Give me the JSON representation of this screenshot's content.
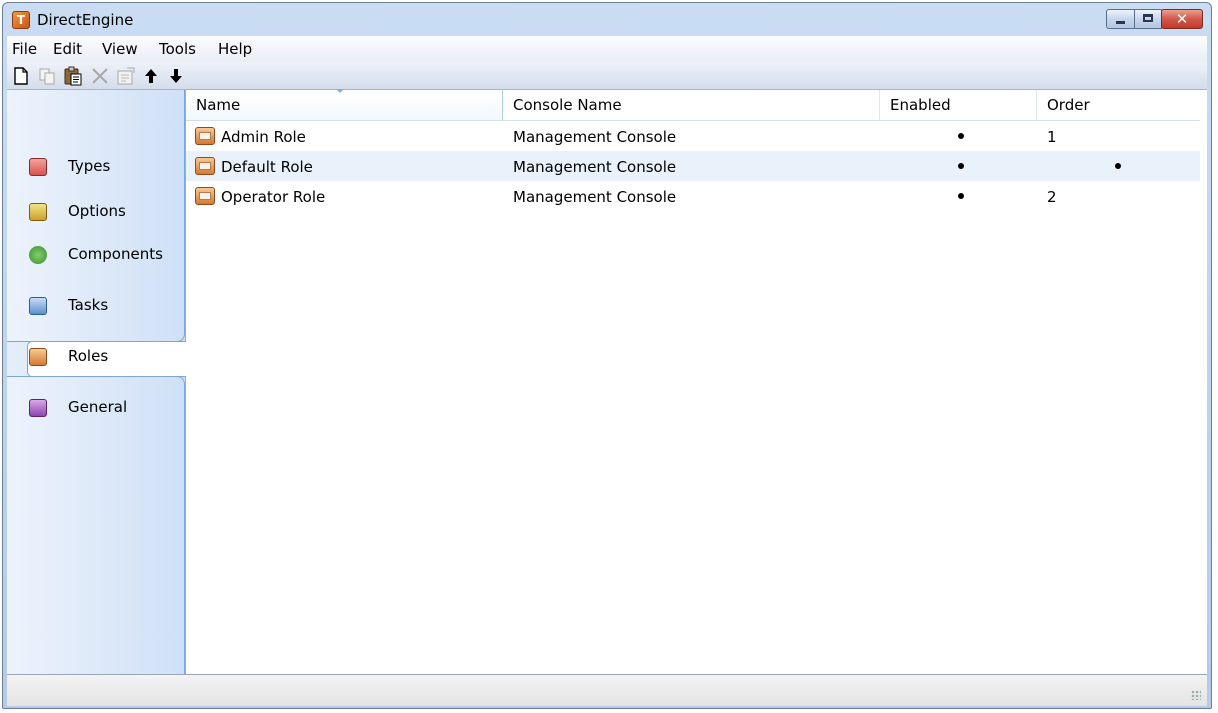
{
  "window": {
    "title": "DirectEngine"
  },
  "menu": {
    "items": [
      "File",
      "Edit",
      "View",
      "Tools",
      "Help"
    ]
  },
  "toolbar": {
    "buttons": [
      {
        "name": "new-icon"
      },
      {
        "name": "copy-icon",
        "disabled": true
      },
      {
        "name": "paste-icon"
      },
      {
        "name": "delete-icon",
        "disabled": true
      },
      {
        "name": "properties-icon",
        "disabled": true
      },
      {
        "name": "move-up-icon",
        "glyph": "🡩"
      },
      {
        "name": "move-down-icon",
        "glyph": "🡫"
      }
    ]
  },
  "nav": {
    "items": [
      {
        "label": "Types",
        "icon": "types-icon",
        "color": "#d9534f"
      },
      {
        "label": "Options",
        "icon": "options-icon",
        "color": "#c9a227"
      },
      {
        "label": "Components",
        "icon": "components-icon",
        "color": "#3c8d2f"
      },
      {
        "label": "Tasks",
        "icon": "tasks-icon",
        "color": "#5b8fd1"
      },
      {
        "label": "Roles",
        "icon": "roles-icon",
        "color": "#d47a34",
        "selected": true
      },
      {
        "label": "General",
        "icon": "general-icon",
        "color": "#8e44ad"
      }
    ]
  },
  "table": {
    "columns": [
      "Name",
      "Console Name",
      "Enabled",
      "Order"
    ],
    "sorted_column": "Name",
    "rows": [
      {
        "name": "Admin Role",
        "console": "Management Console",
        "enabled": true,
        "order": "1",
        "order_dot": false
      },
      {
        "name": "Default Role",
        "console": "Management Console",
        "enabled": true,
        "order": "",
        "order_dot": true
      },
      {
        "name": "Operator Role",
        "console": "Management Console",
        "enabled": true,
        "order": "2",
        "order_dot": false
      }
    ]
  },
  "status": {
    "text": ""
  },
  "colors": {
    "accent": "#7fa5d6",
    "selected_row": "#e9f2fb",
    "close_button": "#c03a2b"
  }
}
